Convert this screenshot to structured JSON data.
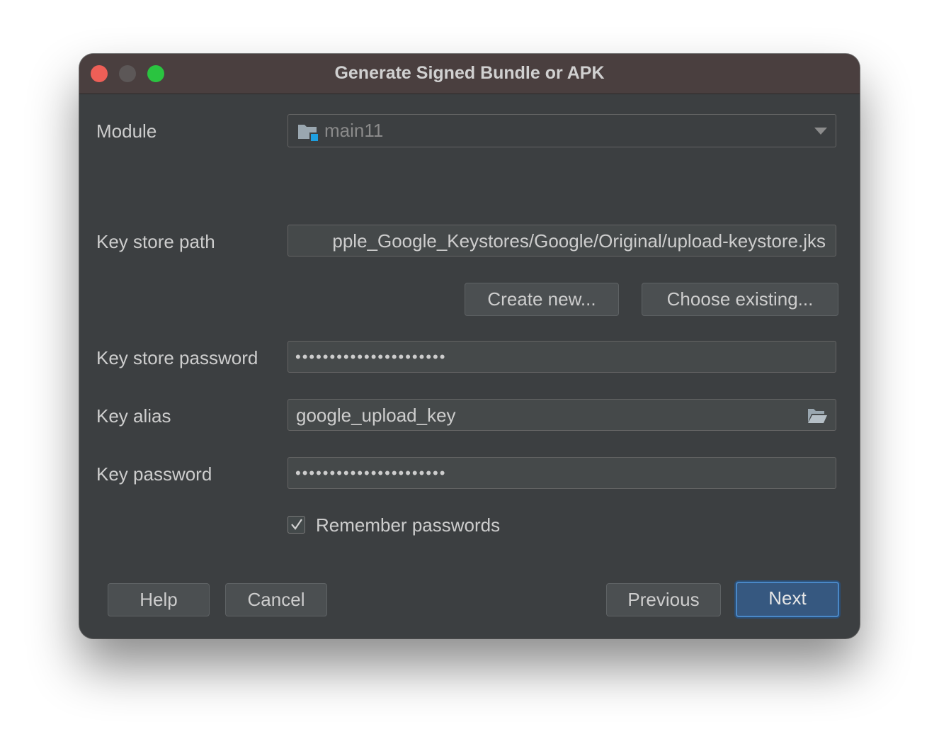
{
  "window": {
    "title": "Generate Signed Bundle or APK"
  },
  "module": {
    "label": "Module",
    "value": "main11",
    "icon": "module-folder-icon"
  },
  "keystore_path": {
    "label": "Key store path",
    "value": "pple_Google_Keystores/Google/Original/upload-keystore.jks"
  },
  "keystore_buttons": {
    "create_new": "Create new...",
    "choose_existing": "Choose existing..."
  },
  "keystore_password": {
    "label": "Key store password",
    "masked": "••••••••••••••••••••••"
  },
  "key_alias": {
    "label": "Key alias",
    "value": "google_upload_key",
    "icon": "folder-open-icon"
  },
  "key_password": {
    "label": "Key password",
    "masked": "••••••••••••••••••••••"
  },
  "remember": {
    "label": "Remember passwords",
    "checked": true
  },
  "footer": {
    "help": "Help",
    "cancel": "Cancel",
    "previous": "Previous",
    "next": "Next"
  },
  "colors": {
    "background": "#3c3f41",
    "titlebar": "#4a3f3f",
    "primary_button": "#365880",
    "close": "#ee5f57",
    "maximize": "#2ac440"
  }
}
